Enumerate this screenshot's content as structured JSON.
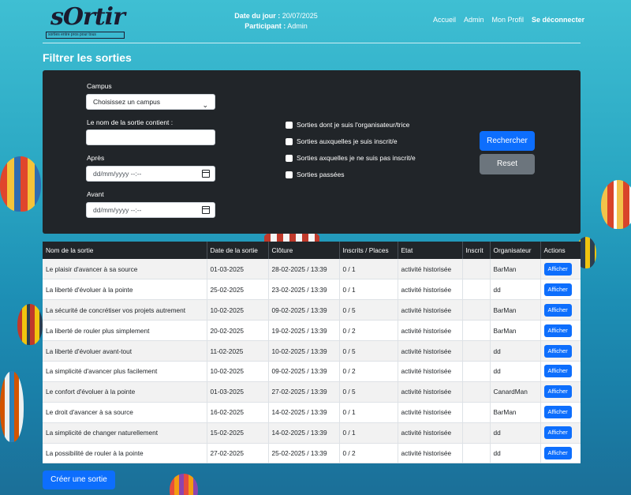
{
  "header": {
    "logo_text": "sOrtir",
    "logo_tagline": "sorties entre pros pour tous",
    "date_label": "Date du jour :",
    "date_value": "20/07/2025",
    "participant_label": "Participant :",
    "participant_value": "Admin",
    "nav": [
      "Accueil",
      "Admin",
      "Mon Profil",
      "Se déconnecter"
    ]
  },
  "page_title": "Filtrer les sorties",
  "filter": {
    "campus_label": "Campus",
    "campus_value": "Choisissez un campus",
    "name_label": "Le nom de la sortie contient :",
    "name_value": "",
    "after_label": "Après",
    "after_placeholder": "dd/mm/yyyy --:--",
    "before_label": "Avant",
    "before_placeholder": "dd/mm/yyyy --:--",
    "checkboxes": [
      "Sorties dont je suis l'organisateur/trice",
      "Sorties auxquelles je suis inscrit/e",
      "Sorties axquelles je ne suis pas inscrit/e",
      "Sorties passées"
    ],
    "search_label": "Rechercher",
    "reset_label": "Reset"
  },
  "table": {
    "headers": [
      "Nom de la sortie",
      "Date de la sortie",
      "Clôture",
      "Inscrits / Places",
      "Etat",
      "Inscrit",
      "Organisateur",
      "Actions"
    ],
    "action_label": "Afficher",
    "rows": [
      [
        "Le plaisir d'avancer à sa source",
        "01-03-2025",
        "28-02-2025 / 13:39",
        "0 / 1",
        "activité historisée",
        "",
        "BarMan"
      ],
      [
        "La liberté d'évoluer à la pointe",
        "25-02-2025",
        "23-02-2025 / 13:39",
        "0 / 1",
        "activité historisée",
        "",
        "dd"
      ],
      [
        "La sécurité de concrétiser vos projets autrement",
        "10-02-2025",
        "09-02-2025 / 13:39",
        "0 / 5",
        "activité historisée",
        "",
        "BarMan"
      ],
      [
        "La liberté de rouler plus simplement",
        "20-02-2025",
        "19-02-2025 / 13:39",
        "0 / 2",
        "activité historisée",
        "",
        "BarMan"
      ],
      [
        "La liberté d'évoluer avant-tout",
        "11-02-2025",
        "10-02-2025 / 13:39",
        "0 / 5",
        "activité historisée",
        "",
        "dd"
      ],
      [
        "La simplicité d'avancer plus facilement",
        "10-02-2025",
        "09-02-2025 / 13:39",
        "0 / 2",
        "activité historisée",
        "",
        "dd"
      ],
      [
        "Le confort d'évoluer à la pointe",
        "01-03-2025",
        "27-02-2025 / 13:39",
        "0 / 5",
        "activité historisée",
        "",
        "CanardMan"
      ],
      [
        "Le droit d'avancer à sa source",
        "16-02-2025",
        "14-02-2025 / 13:39",
        "0 / 1",
        "activité historisée",
        "",
        "BarMan"
      ],
      [
        "La simplicité de changer naturellement",
        "15-02-2025",
        "14-02-2025 / 13:39",
        "0 / 1",
        "activité historisée",
        "",
        "dd"
      ],
      [
        "La possibilité de rouler à la pointe",
        "27-02-2025",
        "25-02-2025 / 13:39",
        "0 / 2",
        "activité historisée",
        "",
        "dd"
      ]
    ]
  },
  "create_button": "Créer une sortie",
  "colors": {
    "primary": "#0d6efd",
    "secondary": "#6c757d",
    "dark_panel": "#212529"
  }
}
